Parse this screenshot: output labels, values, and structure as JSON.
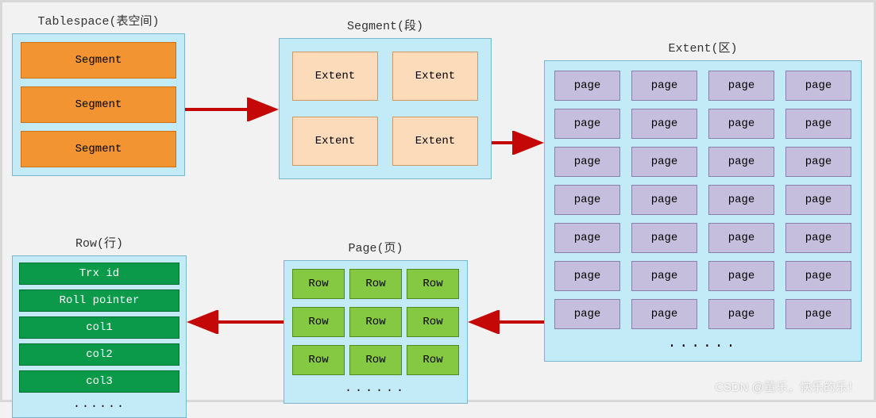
{
  "tablespace": {
    "title": "Tablespace(表空间)",
    "items": [
      "Segment",
      "Segment",
      "Segment"
    ]
  },
  "segment": {
    "title": "Segment(段)",
    "items": [
      "Extent",
      "Extent",
      "Extent",
      "Extent"
    ]
  },
  "extent": {
    "title": "Extent(区)",
    "pageLabel": "page",
    "rows": 7,
    "cols": 4,
    "ellipsis": "......"
  },
  "page": {
    "title": "Page(页)",
    "rowLabel": "Row",
    "rows": 3,
    "cols": 3,
    "ellipsis": "......"
  },
  "row": {
    "title": "Row(行)",
    "fields": [
      "Trx id",
      "Roll pointer",
      "col1",
      "col2",
      "col3"
    ],
    "ellipsis": "......"
  },
  "watermark": "CSDN @董乐，快乐的乐！",
  "colors": {
    "panelBg": "#c2eaf7",
    "segment": "#f29431",
    "extentCell": "#fbdbba",
    "pageCell": "#c5bedc",
    "rowCell": "#84c941",
    "fieldCell": "#0a9a49",
    "arrow": "#c40808"
  }
}
